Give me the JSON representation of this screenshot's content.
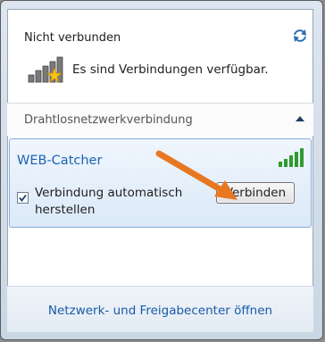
{
  "header": {
    "status": "Nicht verbunden",
    "refresh_icon": "refresh-icon",
    "availability_icon": "network-signal-star-icon",
    "availability_text": "Es sind Verbindungen verfügbar."
  },
  "section": {
    "label": "Drahtlosnetzwerkverbindung",
    "collapse_icon": "chevron-up-icon"
  },
  "network": {
    "name": "WEB-Catcher",
    "signal_icon": "signal-strength-icon",
    "signal_bars": 5,
    "auto_connect_checked": true,
    "auto_connect_label_line1": "Verbindung automatisch",
    "auto_connect_label_line2": "herstellen",
    "connect_button": "Verbinden"
  },
  "footer": {
    "link": "Netzwerk- und Freigabecenter öffnen"
  },
  "colors": {
    "network_name": "#1a64b4",
    "signal_green": "#2e9b2e",
    "arrow": "#e87722",
    "link": "#1a5aa8"
  }
}
